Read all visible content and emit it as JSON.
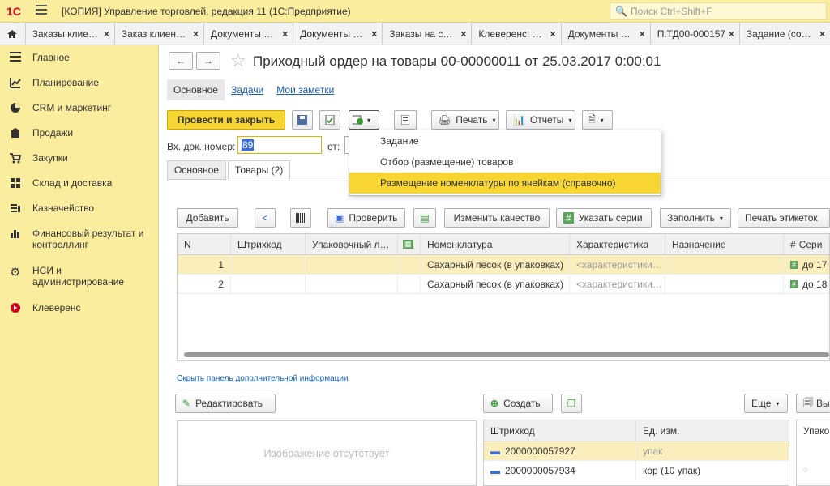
{
  "window": {
    "title": "[КОПИЯ] Управление торговлей, редакция 11  (1С:Предприятие)",
    "search_placeholder": "Поиск Ctrl+Shift+F",
    "logo_text": "1С"
  },
  "tabs": [
    {
      "label": "Заказы клие…"
    },
    {
      "label": "Заказ клиен…"
    },
    {
      "label": "Документы …"
    },
    {
      "label": "Документы …"
    },
    {
      "label": "Заказы на с…"
    },
    {
      "label": "Клеверенс: …"
    },
    {
      "label": "Документы …"
    },
    {
      "label": "П.ТД00-000157"
    },
    {
      "label": "Задание (со…"
    }
  ],
  "sidebar": {
    "items": [
      {
        "label": "Главное",
        "icon": "list-icon"
      },
      {
        "label": "Планирование",
        "icon": "chart-icon"
      },
      {
        "label": "CRM и маркетинг",
        "icon": "pie-icon"
      },
      {
        "label": "Продажи",
        "icon": "bag-icon"
      },
      {
        "label": "Закупки",
        "icon": "cart-icon"
      },
      {
        "label": "Склад и доставка",
        "icon": "grid-icon"
      },
      {
        "label": "Казначейство",
        "icon": "money-icon"
      },
      {
        "label": "Финансовый результат и контроллинг",
        "icon": "bars-icon"
      },
      {
        "label": "НСИ и администрирование",
        "icon": "gear-icon"
      },
      {
        "label": "Клеверенс",
        "icon": "kleverens-icon"
      }
    ]
  },
  "document": {
    "title": "Приходный ордер на товары 00-00000011 от 25.03.2017 0:00:01",
    "subtabs": [
      "Основное",
      "Задачи",
      "Мои заметки"
    ],
    "buttons": {
      "post_close": "Провести и закрыть",
      "print": "Печать",
      "reports": "Отчеты"
    },
    "dropdown": [
      {
        "label": "Задание"
      },
      {
        "label": "Отбор (размещение) товаров"
      },
      {
        "label": "Размещение номенклатуры по ячейкам (справочно)"
      }
    ],
    "fields": {
      "in_doc_label": "Вх. док. номер:",
      "in_doc_value": "89",
      "from_label": "от:"
    },
    "doc_tabs": [
      "Основное",
      "Товары (2)"
    ],
    "toolbar": {
      "add": "Добавить",
      "check": "Проверить",
      "change_quality": "Изменить качество",
      "set_series": "Указать серии",
      "fill": "Заполнить",
      "print_labels": "Печать этикеток"
    },
    "table": {
      "headers": [
        "N",
        "Штрихкод",
        "Упаковочный л…",
        "",
        "Номенклатура",
        "Характеристика",
        "Назначение",
        "Сери"
      ],
      "rows": [
        {
          "n": "1",
          "item": "Сахарный песок (в упаковках)",
          "char": "<характеристики…",
          "series": "до 17"
        },
        {
          "n": "2",
          "item": "Сахарный песок (в упаковках)",
          "char": "<характеристики…",
          "series": "до 18"
        }
      ]
    },
    "hide_panel_link": "Скрыть панель дополнительной информации",
    "lower": {
      "edit": "Редактировать",
      "no_image": "Изображение отсутствует",
      "create": "Создать",
      "more": "Еще",
      "barcode_headers": [
        "Штрихкод",
        "Ед. изм."
      ],
      "barcodes": [
        {
          "code": "2000000057927",
          "unit": "упак"
        },
        {
          "code": "2000000057934",
          "unit": "кор (10 упак)"
        }
      ],
      "right_header": "Упаков",
      "right_button": "Вы"
    }
  }
}
